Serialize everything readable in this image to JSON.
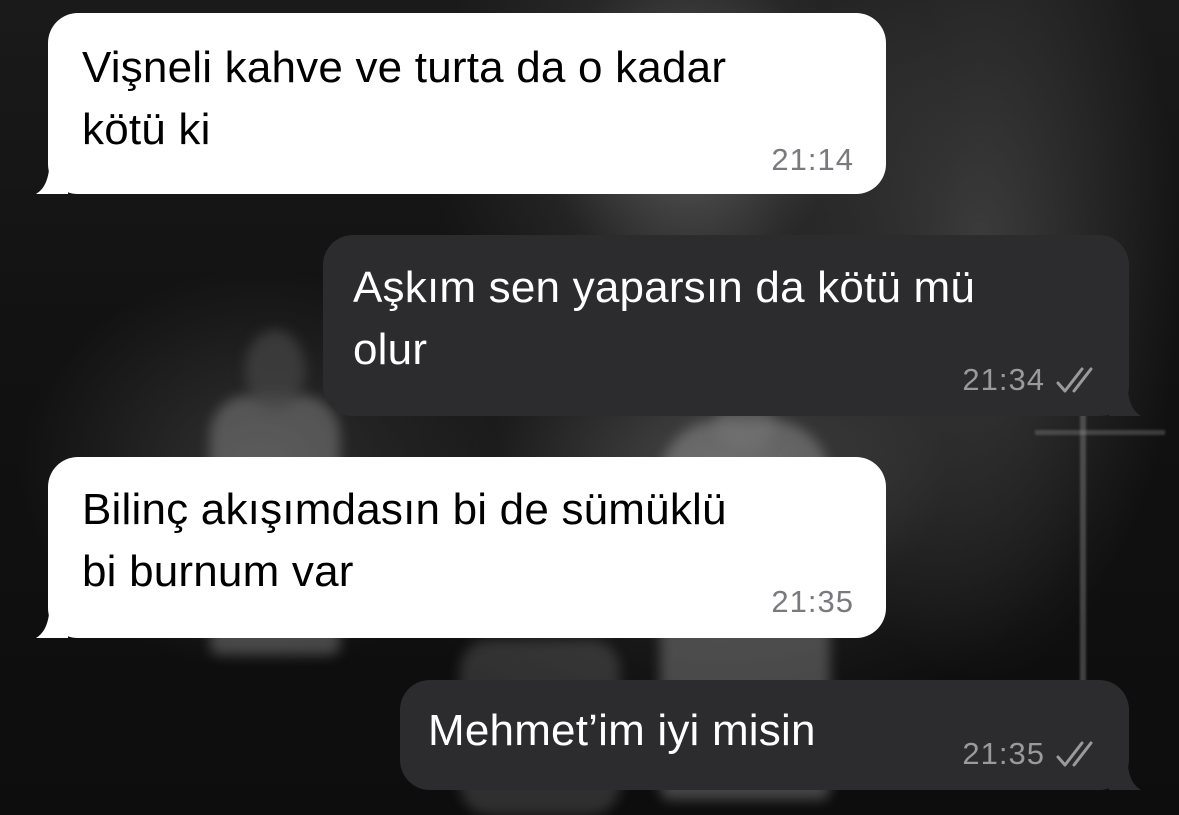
{
  "chat": {
    "messages": [
      {
        "direction": "incoming",
        "text": "Vişneli kahve ve turta da o kadar\nkötü ki",
        "time": "21:14"
      },
      {
        "direction": "outgoing",
        "text": "Aşkım sen yaparsın da kötü mü\nolur",
        "time": "21:34",
        "status_icon": "double-check-icon"
      },
      {
        "direction": "incoming",
        "text": "Bilinç akışımdasın bi de sümüklü\nbi burnum var",
        "time": "21:35"
      },
      {
        "direction": "outgoing",
        "text": "Mehmet’im iyi misin",
        "time": "21:35",
        "status_icon": "double-check-icon"
      }
    ]
  },
  "colors": {
    "incoming_bubble": "#ffffff",
    "outgoing_bubble": "#2c2c2e",
    "incoming_time": "#7a7a7e",
    "outgoing_time": "#9a9a9e"
  }
}
